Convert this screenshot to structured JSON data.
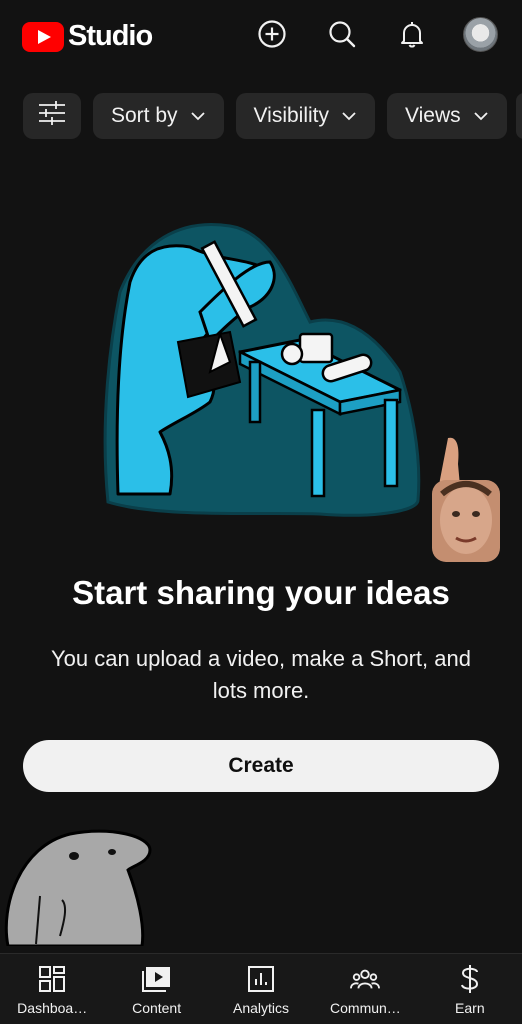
{
  "header": {
    "app_name": "Studio",
    "logo_icon": "youtube-play-logo",
    "actions": [
      {
        "name": "create-icon"
      },
      {
        "name": "search-icon"
      },
      {
        "name": "notifications-bell-icon"
      },
      {
        "name": "account-avatar"
      }
    ],
    "accent_color": "#ff0000"
  },
  "filters": {
    "filter_icon": "sliders-icon",
    "chips": [
      {
        "label": "Sort by"
      },
      {
        "label": "Visibility"
      },
      {
        "label": "Views"
      }
    ]
  },
  "empty_state": {
    "illustration": "person-at-desk-illustration",
    "headline": "Start sharing your ideas",
    "subtext": "You can upload a video, make a Short, and lots more.",
    "button_label": "Create"
  },
  "bottom_nav": {
    "items": [
      {
        "label": "Dashboa…",
        "icon": "dashboard-grid-icon"
      },
      {
        "label": "Content",
        "icon": "content-play-icon"
      },
      {
        "label": "Analytics",
        "icon": "analytics-chart-icon"
      },
      {
        "label": "Commun…",
        "icon": "community-people-icon"
      },
      {
        "label": "Earn",
        "icon": "dollar-icon"
      }
    ]
  },
  "colors": {
    "background": "#121212",
    "chip_background": "#272727",
    "illustration_blue": "#2bbfe8",
    "illustration_teal": "#0d5563"
  }
}
